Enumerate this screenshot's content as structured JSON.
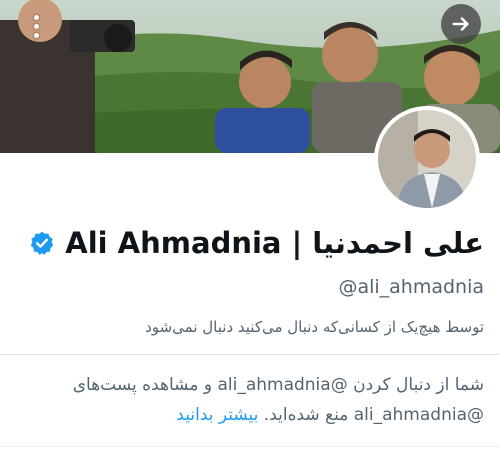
{
  "profile": {
    "display_name": "Ali Ahmadnia | علی احمدنیا",
    "handle": "@ali_ahmadnia",
    "followed_by_text": "توسط هیچ‌یک از کسانی‌که دنبال می‌کنید دنبال نمی‌شود",
    "verified_icon": "verified-badge-icon"
  },
  "notice": {
    "line_text": "شما از دنبال کردن @ali_ahmadnia و مشاهده پست‌های @ali_ahmadnia منع شده‌اید.",
    "learn_more": "بیشتر بدانید"
  },
  "icons": {
    "menu": "more-vertical-icon",
    "share": "arrow-right-icon"
  },
  "colors": {
    "accent": "#1d9bf0",
    "text_primary": "#0f1419",
    "text_secondary": "#536471"
  }
}
